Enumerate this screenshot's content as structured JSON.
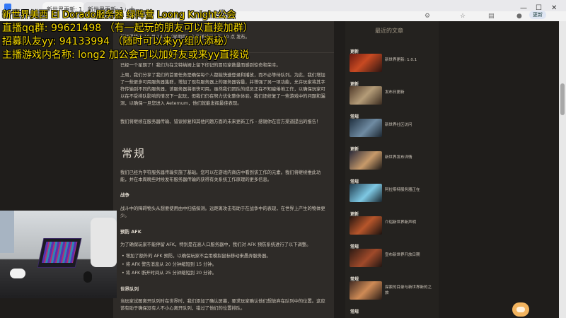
{
  "browser": {
    "tabs": [
      {
        "label": "新世界更新: 1.0.1 - 新..."
      },
      {
        "label": "新世界更新: 1.0.1 - 新..."
      }
    ],
    "update_label": "更新",
    "accent": "#3478f6"
  },
  "overlay": {
    "line1": "新世界美西 El Dorado服务器 绿阵营 Loong Knight公会",
    "line2": "直播qq群: 99621498 （有一起玩的朋友可以直接加群）",
    "line3": "招募队友yy: 94133994 （随时可以来yy组队添秘）",
    "line4": "主播游戏内名称: long2 加公会可以加好友或来yy直接说"
  },
  "article": {
    "meta": "新世界将于 10 月 14 日（星期四）太平洋时间上午 10 点 发布。",
    "intro1": "已经一个星期了！我们为在艾特纳姆上留下印记的冒险家数量而感到惊奇和荣幸。",
    "intro2": "上周，我们分享了我们的首要任务是确保每个人都能快速登录和播放，而不必等待队列。为此，我们增加了一些更多可用服务器集群，增加了现有服务器上的服务器容量，并增强了另一项功能，允许玩家将其字符传输到不同的服务器，该服务器将很快可用。虽然我们团队的成员正在不知疲倦地工作，以确保玩家可以在不受排队影响的情况下一起玩，但我们仍在努力优化整体体验。我们还修复了一些游戏中的问题和漏洞，以确保一旦您进入 Aeternum，他们就能发挥最佳表现。",
    "intro3": "我们将继续在服务器传输、错误修复和其他问题方面的未来更新工作 - 感谢你在官方渠道提出的报告！",
    "section_title": "常规",
    "general1": "我们已经为字符服务器传输实施了基础。您可以在游戏内商店中看到该工作的元素。我们将继续推此功能，并在本周晚些时候发布服务器传输的获得有关系统工作原理的更多信息。",
    "h_combat": "战争",
    "combat1": "战斗中的障碍物头从想要使用由中扫描探测。远距离攻击有助于在战争中的表现，在世界上产生的物体更少。",
    "h_afk": "预防 AFK",
    "afk1": "为了确保玩家不能停留 AFK，特别是在高人口服务器中，我们对 AFK 预防系统进行了以下调整。",
    "bullets": [
      "增加了额外的 AFK 预防，以确保玩家不会用模拟鼠标移动来愚弄服务器。",
      "将 AFK 警告消息从 20 分钟缩短到 15 分钟。",
      "将 AFK 断开时间从 25 分钟缩短到 20 分钟。"
    ],
    "h_queue": "世界队列",
    "queue1": "当玩家试图离开队列时在世界时，我们添加了确认屏幕，要求玩家确认他们想放弃在队列中的位置。这应该有助于确保没有人不小心离开队列，错过了他们的位置排队。"
  },
  "sidebar": {
    "heading": "最近的文章",
    "items": [
      {
        "category": "更新",
        "title": "新世界更新: 1.0.1"
      },
      {
        "category": "更新",
        "title": "发布日更新"
      },
      {
        "category": "常规",
        "title": "新世界社区访问"
      },
      {
        "category": "更新",
        "title": "新世界发布详情"
      },
      {
        "category": "常规",
        "title": "阿拉斯特服务器正在"
      },
      {
        "category": "更新",
        "title": "介绍新世界新声明"
      },
      {
        "category": "常规",
        "title": "宣布新世界开放日期"
      },
      {
        "category": "常规",
        "title": "探索的目录与新世界新的之旅"
      }
    ],
    "last_category": "常规"
  }
}
